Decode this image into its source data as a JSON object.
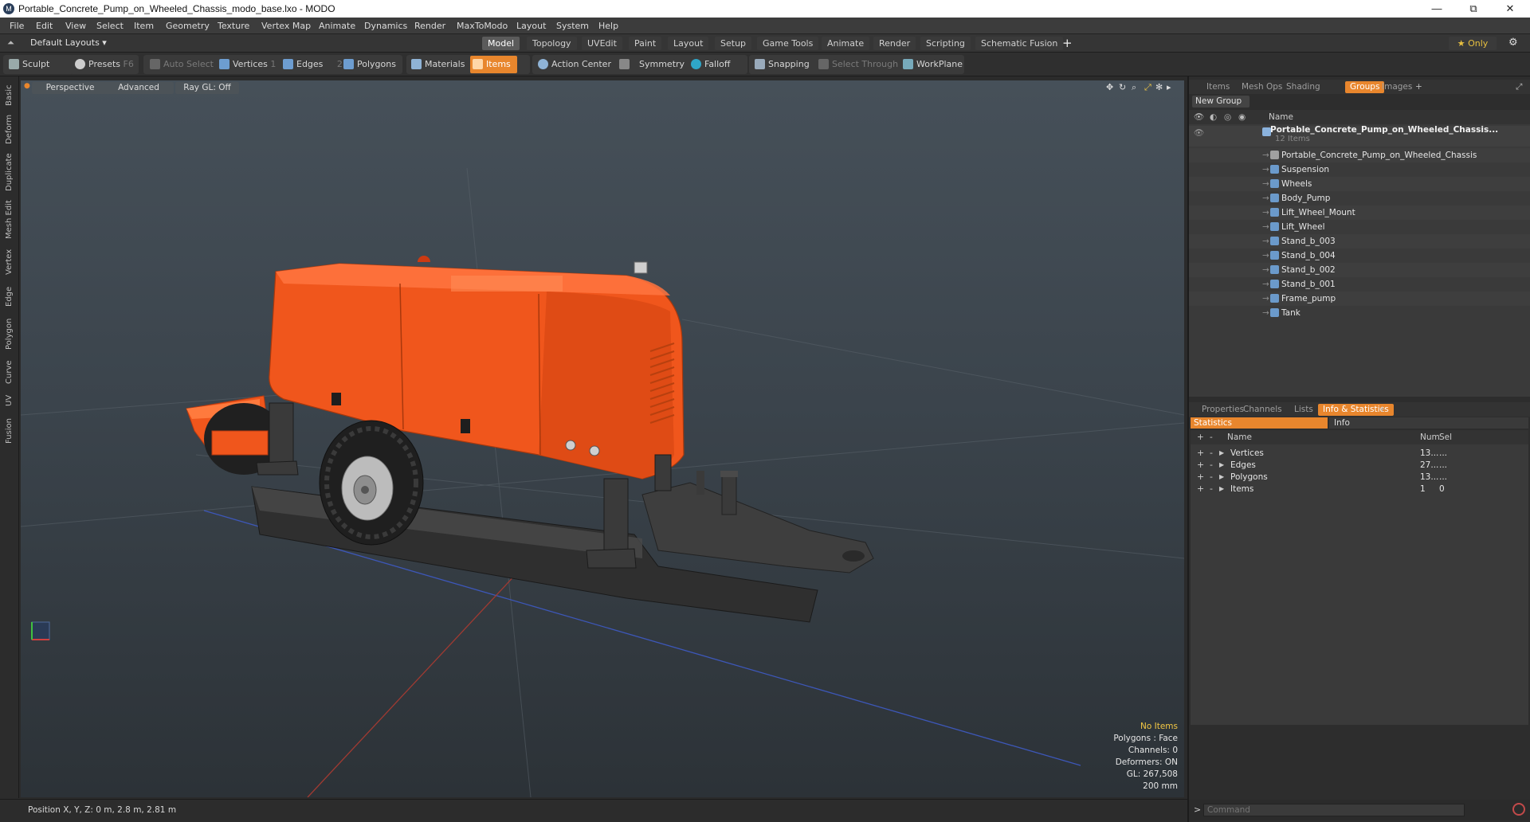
{
  "window": {
    "title": "Portable_Concrete_Pump_on_Wheeled_Chassis_modo_base.lxo - MODO",
    "controls": {
      "minimize": "—",
      "maximize": "⧉",
      "close": "✕"
    }
  },
  "menu": [
    "File",
    "Edit",
    "View",
    "Select",
    "Item",
    "Geometry",
    "Texture",
    "Vertex Map",
    "Animate",
    "Dynamics",
    "Render",
    "MaxToModo",
    "Layout",
    "System",
    "Help"
  ],
  "layout": {
    "selector": "Default Layouts ▾",
    "tabs": [
      "Model",
      "Topology",
      "UVEdit",
      "Paint",
      "Layout",
      "Setup",
      "Game Tools",
      "Animate",
      "Render",
      "Scripting",
      "Schematic Fusion"
    ],
    "active_tab": "Model",
    "add": "+",
    "only_label": "★  Only",
    "gear": "⚙"
  },
  "toolbar": {
    "sculpt": "Sculpt",
    "presets": "Presets",
    "presets_key": "F6",
    "auto_select": "Auto Select",
    "vertices": "Vertices",
    "vertices_count": "1",
    "edges": "Edges",
    "edges_count": "2",
    "polygons": "Polygons",
    "materials": "Materials",
    "items": "Items",
    "action_center": "Action Center",
    "symmetry": "Symmetry",
    "falloff": "Falloff",
    "snapping": "Snapping",
    "select_through": "Select Through",
    "workplane": "WorkPlane"
  },
  "left_tabs": [
    "Basic",
    "Deform",
    "Duplicate",
    "Mesh Edit",
    "Vertex",
    "Edge",
    "Polygon",
    "Curve",
    "UV",
    "Fusion"
  ],
  "viewport": {
    "perspective": "Perspective",
    "advanced": "Advanced",
    "raygl": "Ray GL: Off",
    "info": {
      "selection": "No Items",
      "polygons": "Polygons : Face",
      "channels": "Channels: 0",
      "deformers": "Deformers: ON",
      "gl": "GL: 267,508",
      "scale": "200 mm"
    }
  },
  "status": {
    "position": "Position X, Y, Z:  0 m, 2.8 m, 2.81 m"
  },
  "groups_panel": {
    "tabs": [
      "Items",
      "Mesh Ops",
      "Shading",
      "Groups",
      "Images"
    ],
    "active": "Groups",
    "new_group": "New Group",
    "col_name": "Name",
    "root": {
      "name": "Portable_Concrete_Pump_on_Wheeled_Chassis...",
      "count": "12 Items"
    },
    "items": [
      "Portable_Concrete_Pump_on_Wheeled_Chassis",
      "Suspension",
      "Wheels",
      "Body_Pump",
      "Lift_Wheel_Mount",
      "Lift_Wheel",
      "Stand_b_003",
      "Stand_b_004",
      "Stand_b_002",
      "Stand_b_001",
      "Frame_pump",
      "Tank"
    ]
  },
  "stats_panel": {
    "tabs": [
      "Properties",
      "Channels",
      "Lists",
      "Info & Statistics"
    ],
    "active": "Info & Statistics",
    "sub_tabs": [
      "Statistics",
      "Info"
    ],
    "columns": [
      "Name",
      "Num",
      "Sel"
    ],
    "rows": [
      {
        "name": "Vertices",
        "num": "13...",
        "sel": "..."
      },
      {
        "name": "Edges",
        "num": "27...",
        "sel": "..."
      },
      {
        "name": "Polygons",
        "num": "13...",
        "sel": "..."
      },
      {
        "name": "Items",
        "num": "1",
        "sel": "0"
      }
    ]
  },
  "command": {
    "prompt": ">",
    "placeholder": "Command"
  },
  "colors": {
    "accent": "#e8862d",
    "pump_body": "#f0561c",
    "chassis": "#3c3c3c"
  }
}
